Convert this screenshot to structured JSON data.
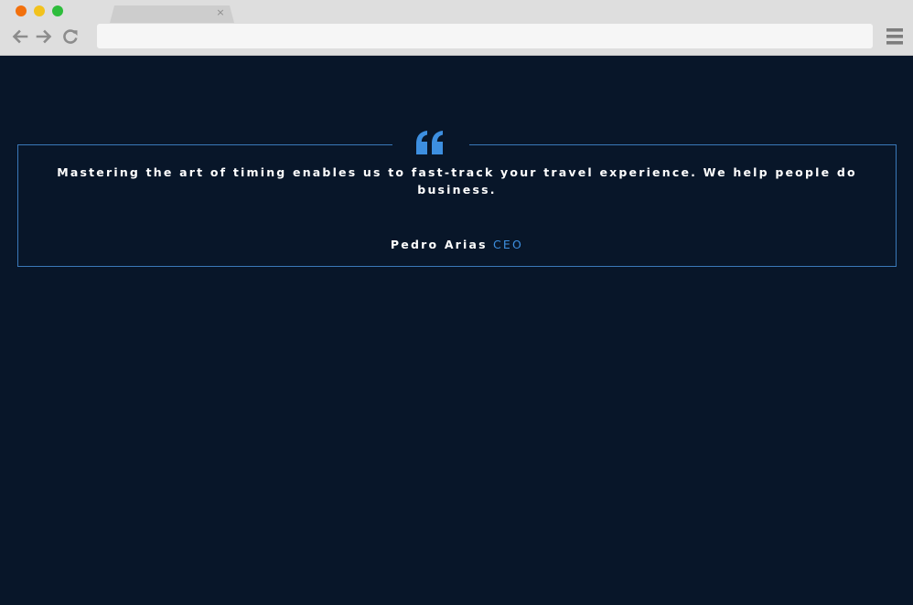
{
  "browser": {
    "tab_close": "×",
    "address_value": "",
    "icons": {
      "back": "arrow-left-icon",
      "forward": "arrow-right-icon",
      "reload": "reload-icon",
      "menu": "hamburger-menu-icon"
    },
    "traffic_light_colors": [
      "#f2700c",
      "#f2c21d",
      "#2ebd3c"
    ]
  },
  "testimonial": {
    "quote_icon": "quote-icon",
    "quote": "Mastering the art of timing enables us to fast-track your travel experience. We help people do business.",
    "author_name": "Pedro Arias",
    "author_role": "CEO"
  },
  "colors": {
    "background": "#081629",
    "accent": "#3d8fe0",
    "border": "#3a78b8",
    "text": "#ffffff"
  }
}
